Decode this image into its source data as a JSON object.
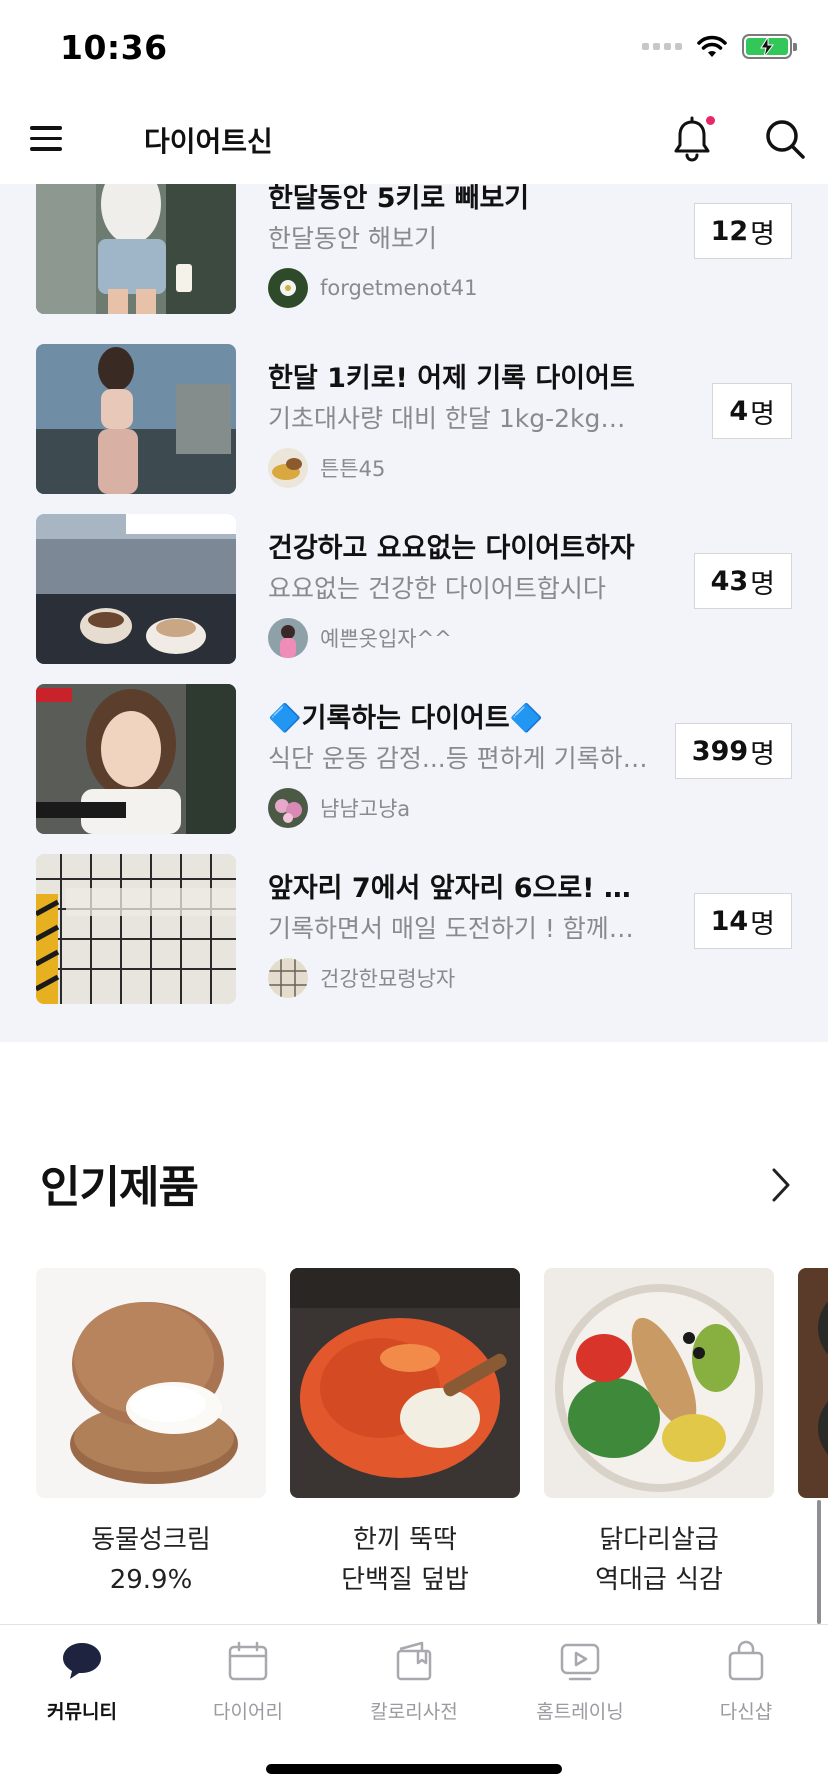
{
  "status_bar": {
    "time": "10:36"
  },
  "header": {
    "title": "다이어트신"
  },
  "challenges": [
    {
      "title": "한달동안 5키로 빼보기",
      "description": "한달동안 해보기",
      "author": "forgetmenot41",
      "members": "12",
      "unit": "명"
    },
    {
      "title": "한달 1키로! 어제 기록 다이어트",
      "description": "기초대사량 대비 한달 1kg-2kg감…",
      "author": "튼튼45",
      "members": "4",
      "unit": "명"
    },
    {
      "title": "건강하고 요요없는 다이어트하자",
      "description": "요요없는 건강한 다이어트합시다",
      "author": "예쁜옷입자^^",
      "members": "43",
      "unit": "명"
    },
    {
      "title": "🔷기록하는 다이어트🔷",
      "description": "식단 운동 감정...등 편하게 기록하…",
      "author": "냠냠고냥a",
      "members": "399",
      "unit": "명"
    },
    {
      "title": "앞자리 7에서 앞자리 6으로! 기…",
      "description": "기록하면서 매일 도전하기 ! 함께…",
      "author": "건강한묘령낭자",
      "members": "14",
      "unit": "명"
    }
  ],
  "popular": {
    "title": "인기제품",
    "products": [
      {
        "line1": "동물성크림",
        "line2": "29.9%"
      },
      {
        "line1": "한끼 뚝딱",
        "line2": "단백질 덮밥"
      },
      {
        "line1": "닭다리살급",
        "line2": "역대급 식감"
      }
    ]
  },
  "tabs": [
    {
      "label": "커뮤니티",
      "icon": "chat-bubble-icon",
      "active": true
    },
    {
      "label": "다이어리",
      "icon": "calendar-icon",
      "active": false
    },
    {
      "label": "칼로리사전",
      "icon": "book-icon",
      "active": false
    },
    {
      "label": "홈트레이닝",
      "icon": "play-video-icon",
      "active": false
    },
    {
      "label": "다신샵",
      "icon": "shopping-bag-icon",
      "active": false
    }
  ],
  "colors": {
    "accent_dot": "#e8266a",
    "list_background": "#f3f4fa",
    "battery": "#33c759"
  }
}
